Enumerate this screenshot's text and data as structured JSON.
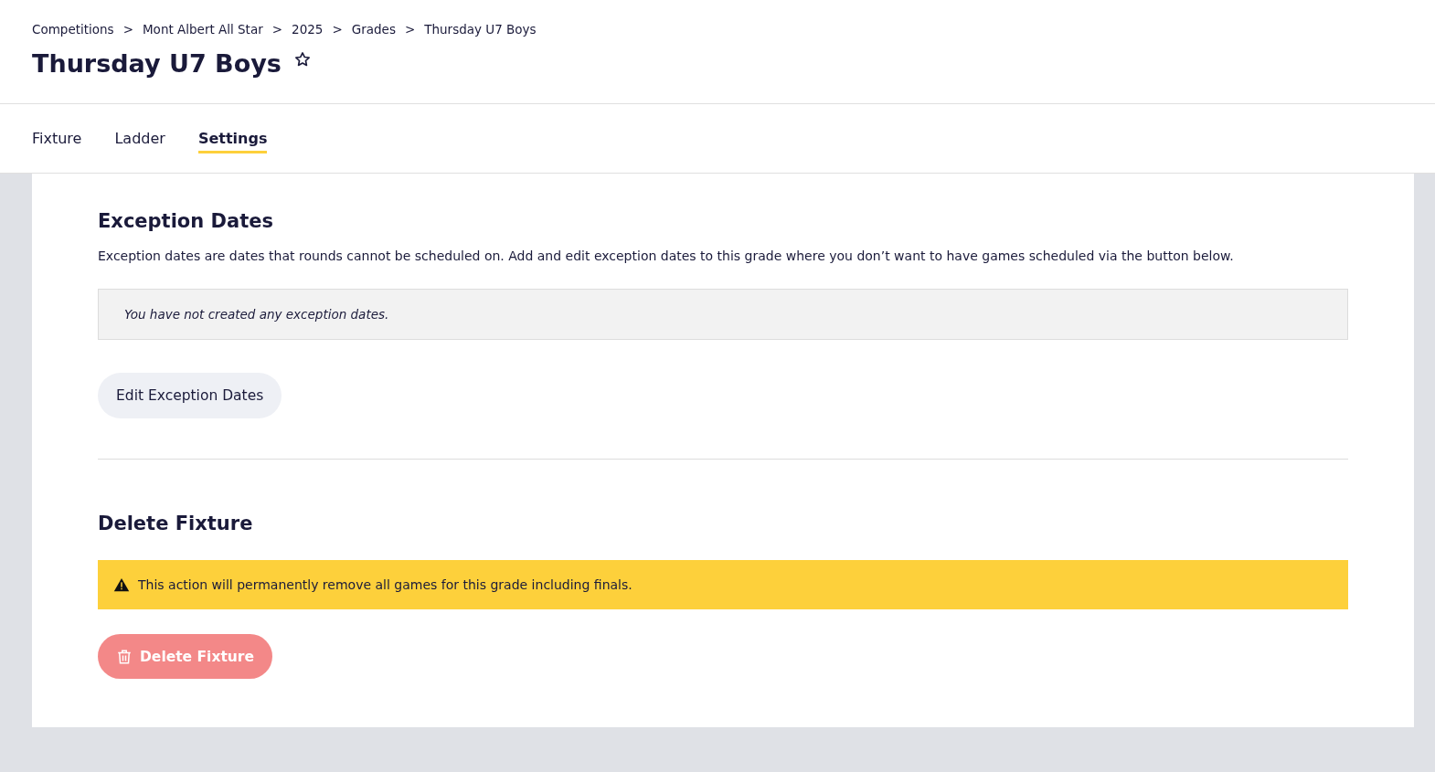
{
  "breadcrumbs": [
    {
      "label": "Competitions"
    },
    {
      "label": "Mont Albert All Star"
    },
    {
      "label": "2025"
    },
    {
      "label": "Grades"
    },
    {
      "label": "Thursday U7 Boys"
    }
  ],
  "breadcrumb_separator": ">",
  "title": "Thursday U7 Boys",
  "starred": false,
  "tabs": [
    {
      "label": "Fixture",
      "selected": false
    },
    {
      "label": "Ladder",
      "selected": false
    },
    {
      "label": "Settings",
      "selected": true
    }
  ],
  "exception_dates": {
    "heading": "Exception Dates",
    "description": "Exception dates are dates that rounds cannot be scheduled on. Add and edit exception dates to this grade where you don’t want to have games scheduled via the button below.",
    "empty_message": "You have not created any exception dates.",
    "button": "Edit Exception Dates"
  },
  "delete_fixture": {
    "heading": "Delete Fixture",
    "warning": "This action will permanently remove all games for this grade including finals.",
    "button": {
      "label": "Delete Fixture",
      "disabled": true
    }
  }
}
